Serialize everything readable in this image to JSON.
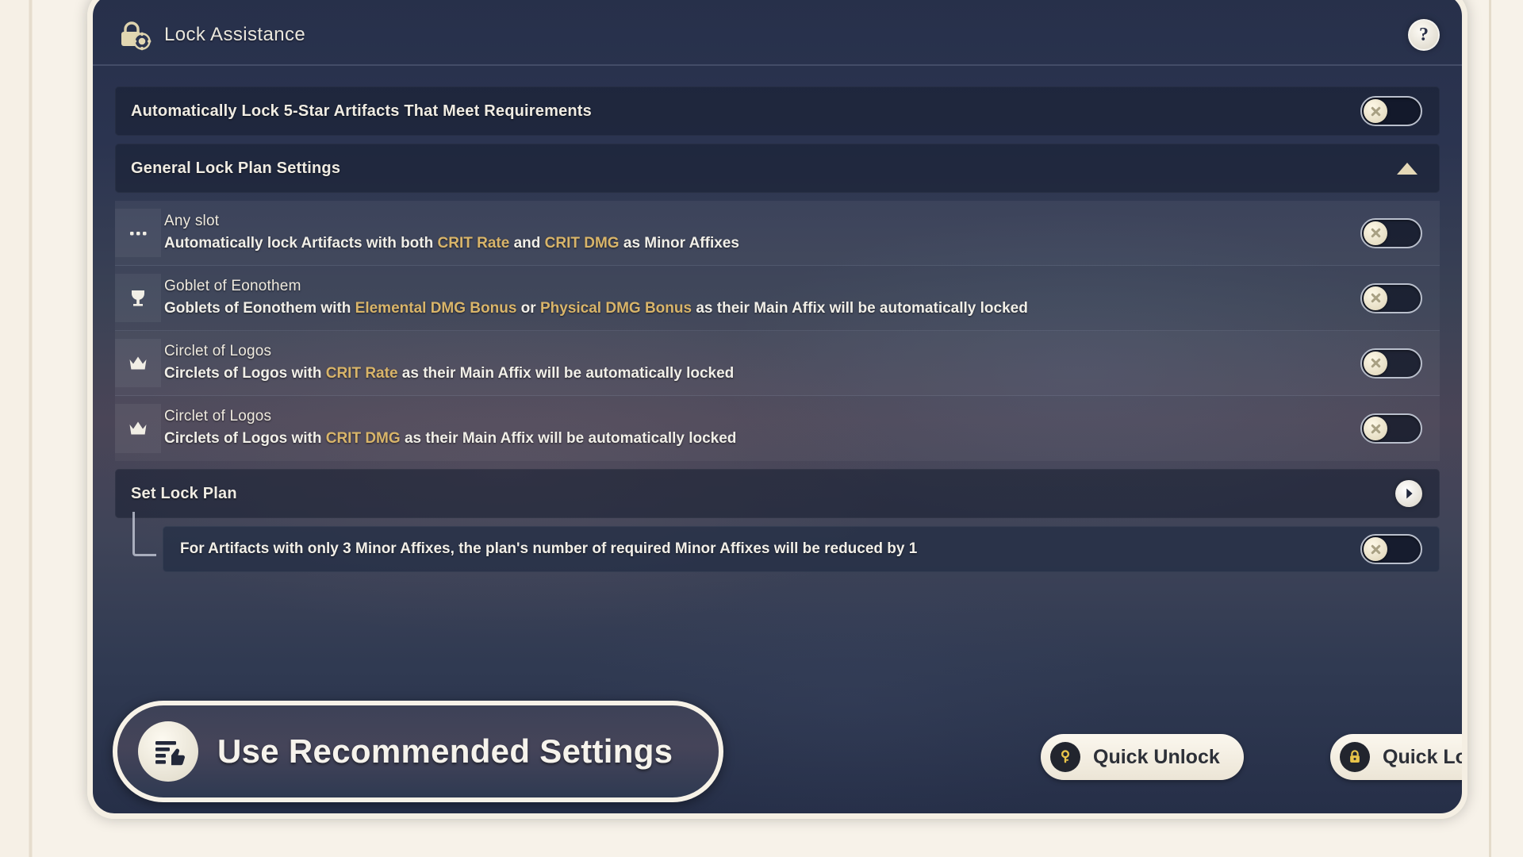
{
  "header": {
    "title": "Lock Assistance",
    "lock_gear_icon": "lock-gear-icon",
    "help_label": "?"
  },
  "main": {
    "auto_lock_row": {
      "label": "Automatically Lock 5-Star Artifacts That Meet Requirements",
      "toggle_state": "off"
    },
    "general_section": {
      "label": "General Lock Plan Settings",
      "expanded": true,
      "collapse_icon": "triangle-up-icon"
    },
    "plan_rows": [
      {
        "icon": "ellipsis-icon",
        "title": "Any slot",
        "desc_parts": [
          {
            "text": "Automatically lock Artifacts with both ",
            "highlight": false
          },
          {
            "text": "CRIT Rate",
            "highlight": true
          },
          {
            "text": " and ",
            "highlight": false
          },
          {
            "text": "CRIT DMG",
            "highlight": true
          },
          {
            "text": " as Minor Affixes",
            "highlight": false
          }
        ],
        "toggle_state": "off"
      },
      {
        "icon": "goblet-icon",
        "title": "Goblet of Eonothem",
        "desc_parts": [
          {
            "text": "Goblets of Eonothem with ",
            "highlight": false
          },
          {
            "text": "Elemental DMG Bonus",
            "highlight": true
          },
          {
            "text": " or ",
            "highlight": false
          },
          {
            "text": "Physical DMG Bonus",
            "highlight": true
          },
          {
            "text": " as their Main Affix will be automatically locked",
            "highlight": false
          }
        ],
        "toggle_state": "off"
      },
      {
        "icon": "crown-icon",
        "title": "Circlet of Logos",
        "desc_parts": [
          {
            "text": "Circlets of Logos with ",
            "highlight": false
          },
          {
            "text": "CRIT Rate",
            "highlight": true
          },
          {
            "text": " as their Main Affix will be automatically locked",
            "highlight": false
          }
        ],
        "toggle_state": "off"
      },
      {
        "icon": "crown-icon",
        "title": "Circlet of Logos",
        "desc_parts": [
          {
            "text": "Circlets of Logos with ",
            "highlight": false
          },
          {
            "text": "CRIT DMG",
            "highlight": true
          },
          {
            "text": " as their Main Affix will be automatically locked",
            "highlight": false
          }
        ],
        "toggle_state": "off"
      }
    ],
    "set_lock_plan": {
      "label": "Set Lock Plan",
      "go_icon": "chevron-right-icon"
    },
    "sub_note": {
      "text": "For Artifacts with only 3 Minor Affixes, the plan's number of required Minor Affixes will be reduced by 1",
      "toggle_state": "off"
    }
  },
  "footer": {
    "recommend": {
      "label": "Use Recommended Settings",
      "icon": "recommend-list-thumbsup-icon"
    },
    "quick_unlock": {
      "label": "Quick Unlock",
      "icon": "key-icon"
    },
    "quick_lock": {
      "label": "Quick Lock",
      "icon": "padlock-icon"
    }
  },
  "colors": {
    "highlight_gold": "#d9b56a",
    "panel_border_cream": "#f5efe3",
    "background_cream": "#f7f2e9",
    "text_light": "#f0ece3",
    "pill_fill": "#fbf7ee"
  }
}
